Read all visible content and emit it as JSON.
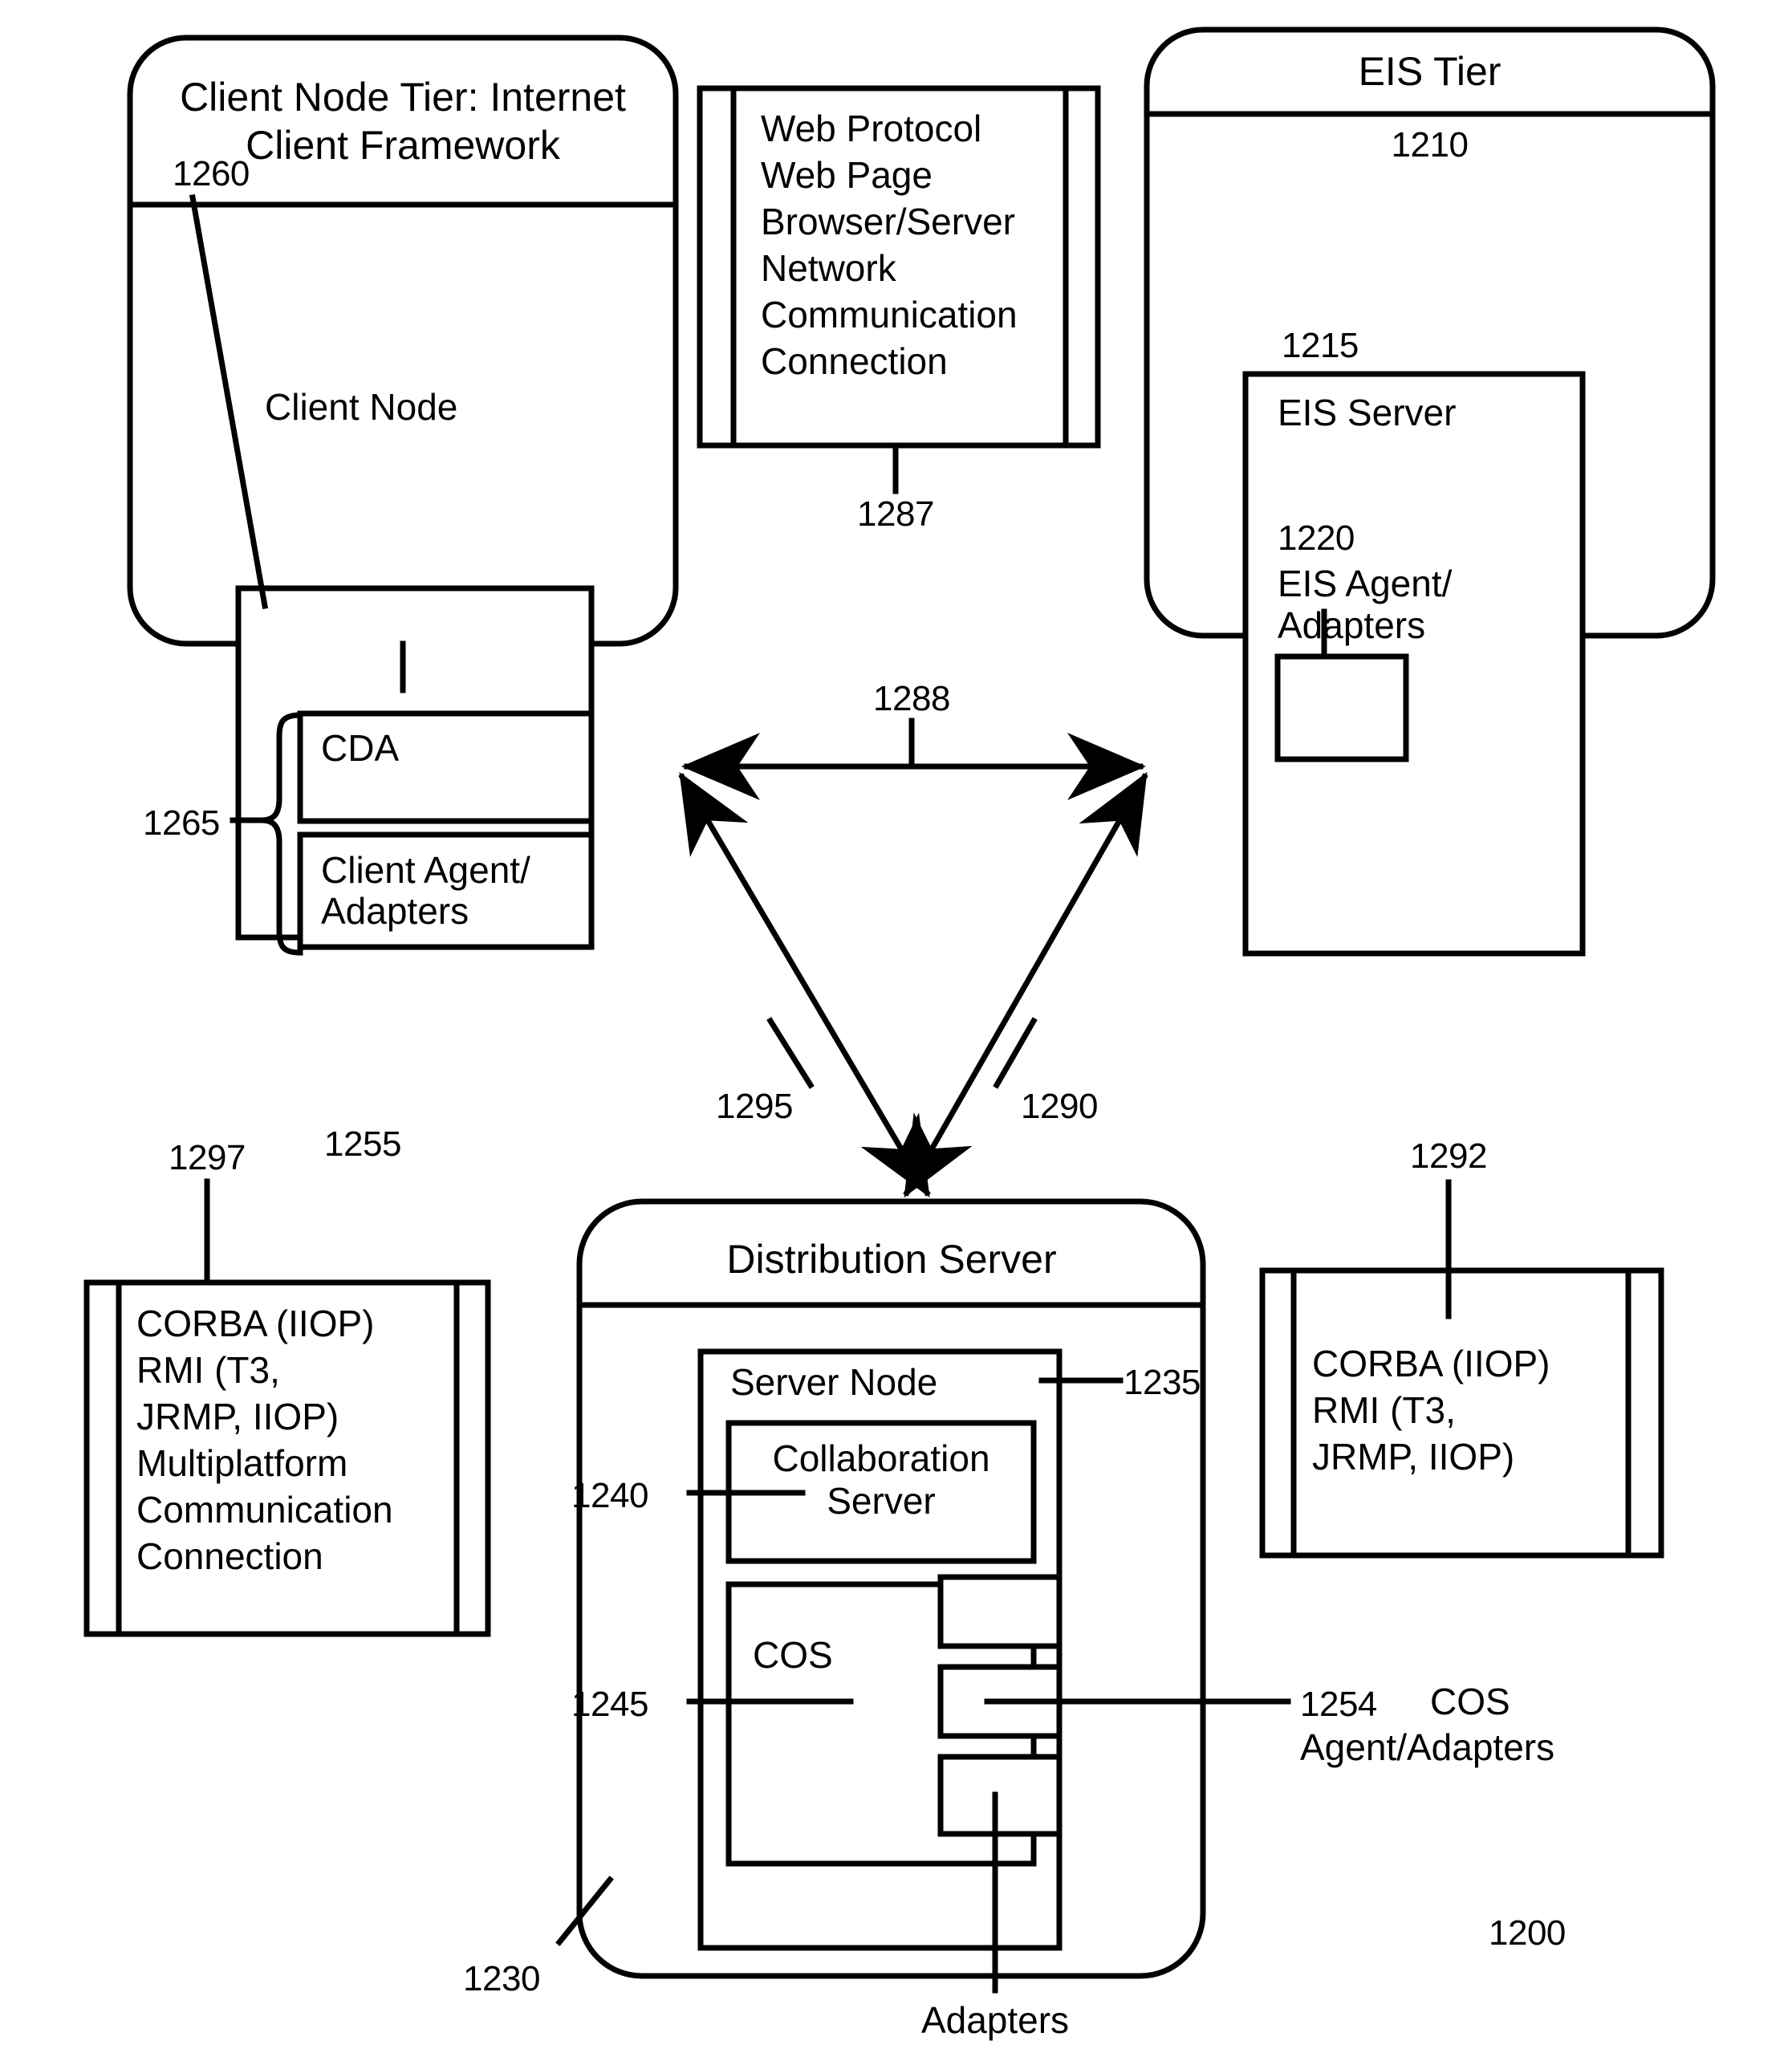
{
  "figure": {
    "figure_ref": "1200"
  },
  "client_tier": {
    "title_line1": "Client Node Tier: Internet",
    "title_line2": "Client Framework",
    "ref": "1255",
    "client_node": {
      "label": "Client Node",
      "ref": "1260",
      "brace_ref": "1265",
      "cda_label": "CDA",
      "agent_line1": "Client Agent/",
      "agent_line2": "Adapters"
    }
  },
  "web_protocol": {
    "ref": "1287",
    "lines": [
      "Web Protocol",
      "Web Page",
      "Browser/Server",
      "Network",
      "Communication",
      "Connection"
    ]
  },
  "eis_tier": {
    "title": "EIS Tier",
    "ref": "1210",
    "eis_server": {
      "label": "EIS Server",
      "ref": "1215",
      "agent_ref": "1220",
      "agent_line1": "EIS Agent/",
      "agent_line2": "Adapters"
    }
  },
  "connectors": {
    "client_eis_ref": "1288",
    "client_dist_ref": "1295",
    "eis_dist_ref": "1290"
  },
  "corba_left": {
    "ref": "1297",
    "lines": [
      "CORBA (IIOP)",
      "RMI (T3,",
      "JRMP, IIOP)",
      "Multiplatform",
      "Communication",
      "Connection"
    ]
  },
  "corba_right": {
    "ref": "1292",
    "lines": [
      "CORBA (IIOP)",
      "RMI (T3,",
      "JRMP, IIOP)"
    ]
  },
  "distribution_server": {
    "title": "Distribution Server",
    "ref": "1230",
    "server_node": {
      "label": "Server Node",
      "ref": "1235",
      "collab_ref": "1240",
      "collab_line1": "Collaboration",
      "collab_line2": "Server",
      "cos_label": "COS",
      "cos_ref": "1245",
      "cos_agent_ref": "1254",
      "cos_agent_line1": "COS",
      "cos_agent_line2": "Agent/Adapters",
      "adapters_label": "Adapters"
    }
  }
}
